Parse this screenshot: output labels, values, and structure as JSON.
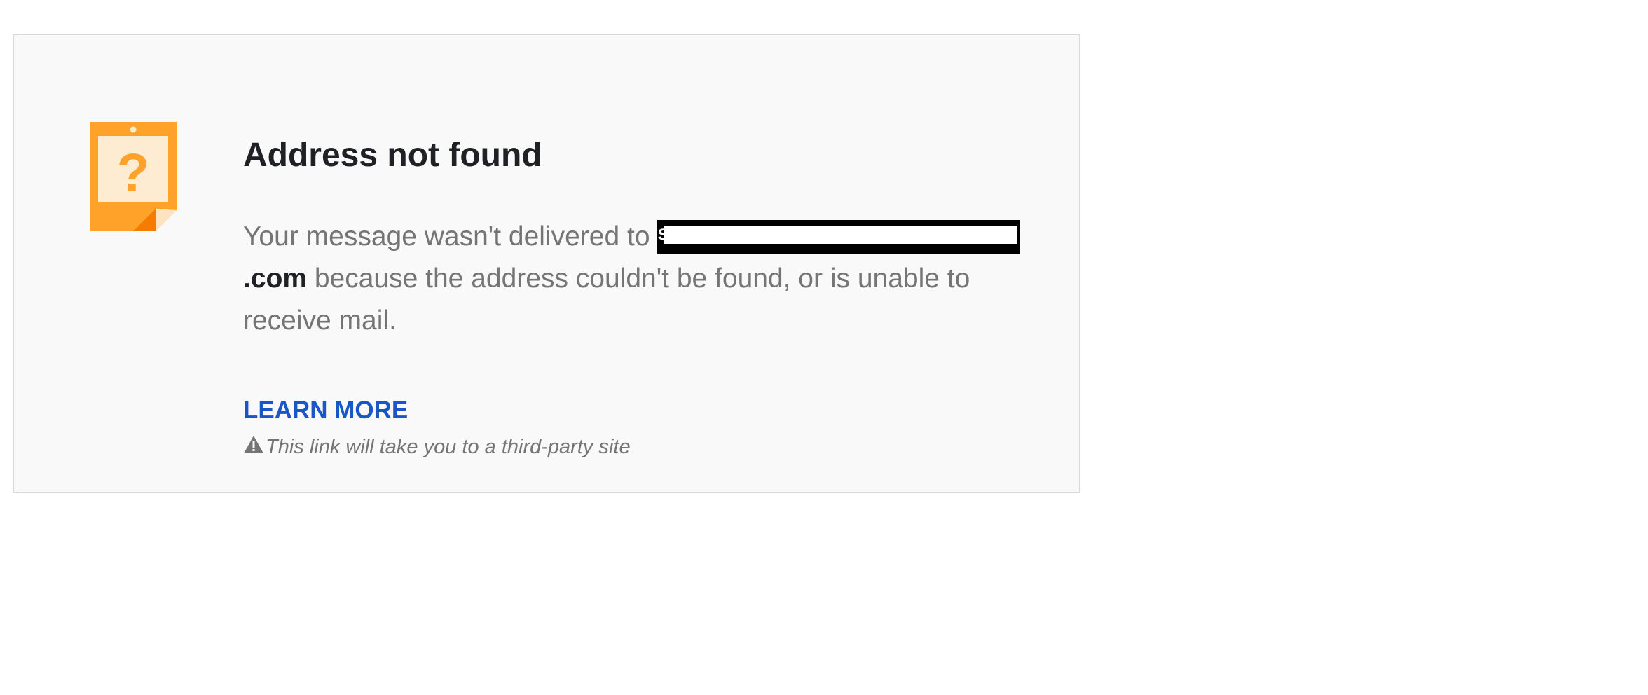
{
  "error_card": {
    "title": "Address not found",
    "message_before": "Your message wasn't delivered to ",
    "recipient_domain_suffix": ".com",
    "message_after": " because the address couldn't be found, or is unable to receive mail.",
    "learn_more_label": "LEARN MORE",
    "third_party_notice": "This link will take you to a third-party site",
    "icon": "question-note-icon",
    "warning_icon": "warning-triangle-icon"
  },
  "colors": {
    "card_background": "#f9f9f9",
    "card_border": "#dadada",
    "icon_orange": "#fea22a",
    "title_text": "#202124",
    "body_text": "#757575",
    "link_blue": "#1a57c6"
  }
}
